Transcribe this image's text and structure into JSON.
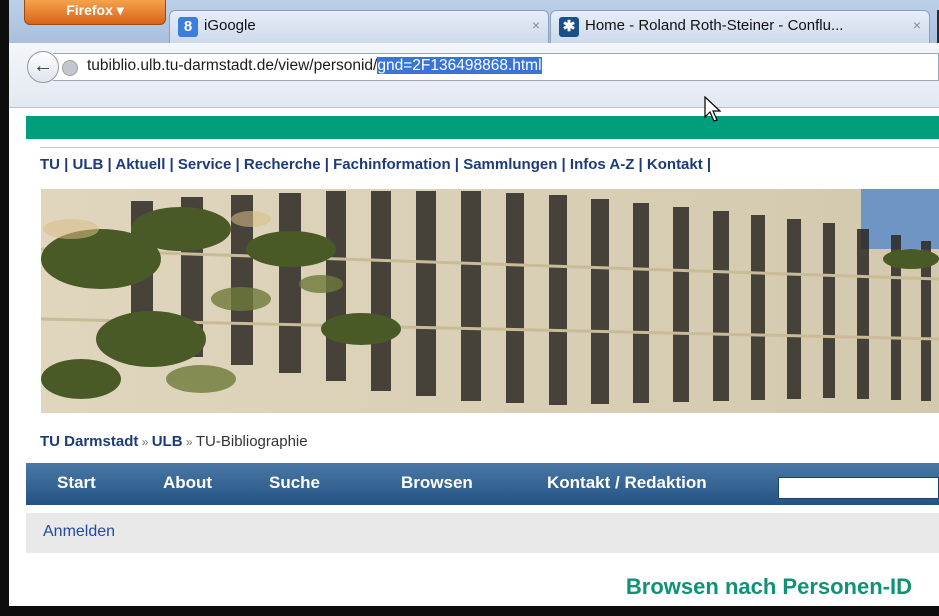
{
  "browser": {
    "menu_button": "Firefox ▾",
    "tabs": [
      {
        "title": "iGoogle",
        "favicon": "g-icon",
        "close": "×",
        "active": false
      },
      {
        "title": "Home - Roland Roth-Steiner - Conflu...",
        "favicon": "confluence-icon",
        "close": "×",
        "active": false
      }
    ],
    "back_glyph": "←",
    "url_plain": "tubiblio.ulb.tu-darmstadt.de/view/personid/",
    "url_selected": "gnd=2F136498868.html"
  },
  "site": {
    "top_nav": [
      "TU",
      "ULB",
      "Aktuell",
      "Service",
      "Recherche",
      "Fachinformation",
      "Sammlungen",
      "Infos A-Z",
      "Kontakt"
    ],
    "nav_separator": " | ",
    "nav_trailing": " |",
    "breadcrumb": {
      "items": [
        "TU Darmstadt",
        "ULB"
      ],
      "arrow": " » ",
      "current": "TU-Bibliographie"
    },
    "menu": [
      "Start",
      "About",
      "Suche",
      "Browsen",
      "Kontakt / Redaktion"
    ],
    "search_value": "",
    "login_label": "Anmelden",
    "page_title": "Browsen nach Personen-ID"
  },
  "colors": {
    "accent_green": "#009e7a",
    "menu_blue": "#245383",
    "link_blue": "#1d3b7b",
    "selection": "#3875d7"
  }
}
